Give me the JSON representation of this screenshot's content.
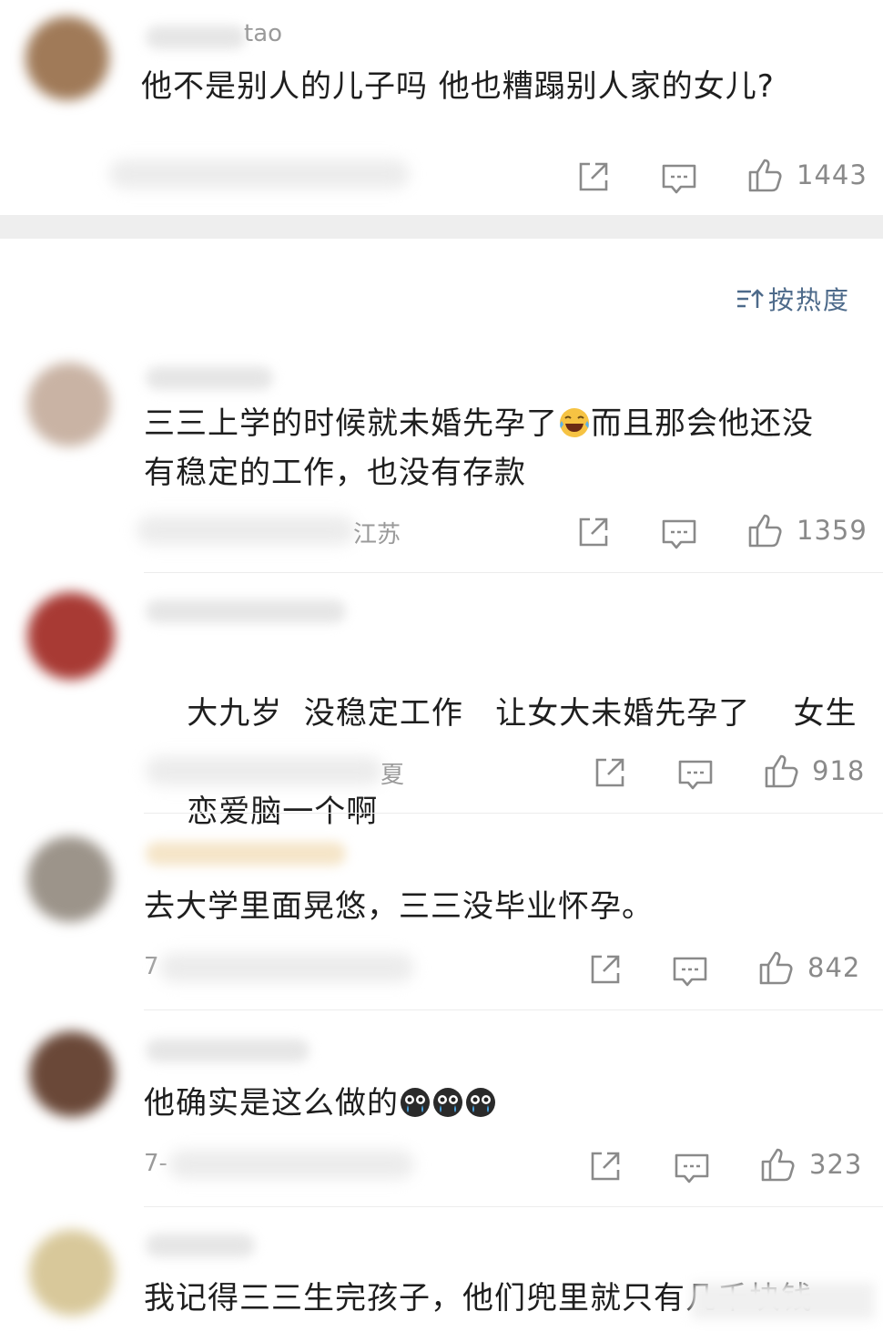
{
  "sort": {
    "label": "按热度",
    "icon": "sort-icon"
  },
  "comments": [
    {
      "name_visible": "tao",
      "text": "他不是别人的儿子吗 他也糟蹋别人家的女儿?",
      "meta_visible": "",
      "likes": "1443"
    },
    {
      "name_visible": "",
      "text_line1": "三三上学的时候就未婚先孕了",
      "emoji": "laughing-tears-emoji",
      "text_line1b": "而且那会他还没",
      "text_line2": "有稳定的工作，也没有存款",
      "meta_visible": "江苏",
      "likes": "1359"
    },
    {
      "name_visible": "",
      "text_line1": "大九岁  没稳定工作   让女大未婚先孕了    女生",
      "text_line2": "恋爱脑一个啊",
      "meta_visible": "夏",
      "likes": "918"
    },
    {
      "name_visible": "",
      "text": "去大学里面晃悠，三三没毕业怀孕。",
      "meta_visible": "7",
      "likes": "842"
    },
    {
      "name_visible": "",
      "text": "他确实是这么做的",
      "emojis": [
        "crying-face-emoji",
        "crying-face-emoji",
        "crying-face-emoji"
      ],
      "meta_visible": "7-",
      "likes": "323"
    },
    {
      "name_visible": "",
      "text": "我记得三三生完孩子，他们兜里就只有几千块钱"
    }
  ],
  "icons": {
    "share": "share-icon",
    "comment": "comment-icon",
    "like": "thumbs-up-icon"
  },
  "colors": {
    "accent": "#4d6a8a",
    "meta": "#9a9a9a",
    "text": "#1e1e1e",
    "separator": "#eeeeee"
  }
}
